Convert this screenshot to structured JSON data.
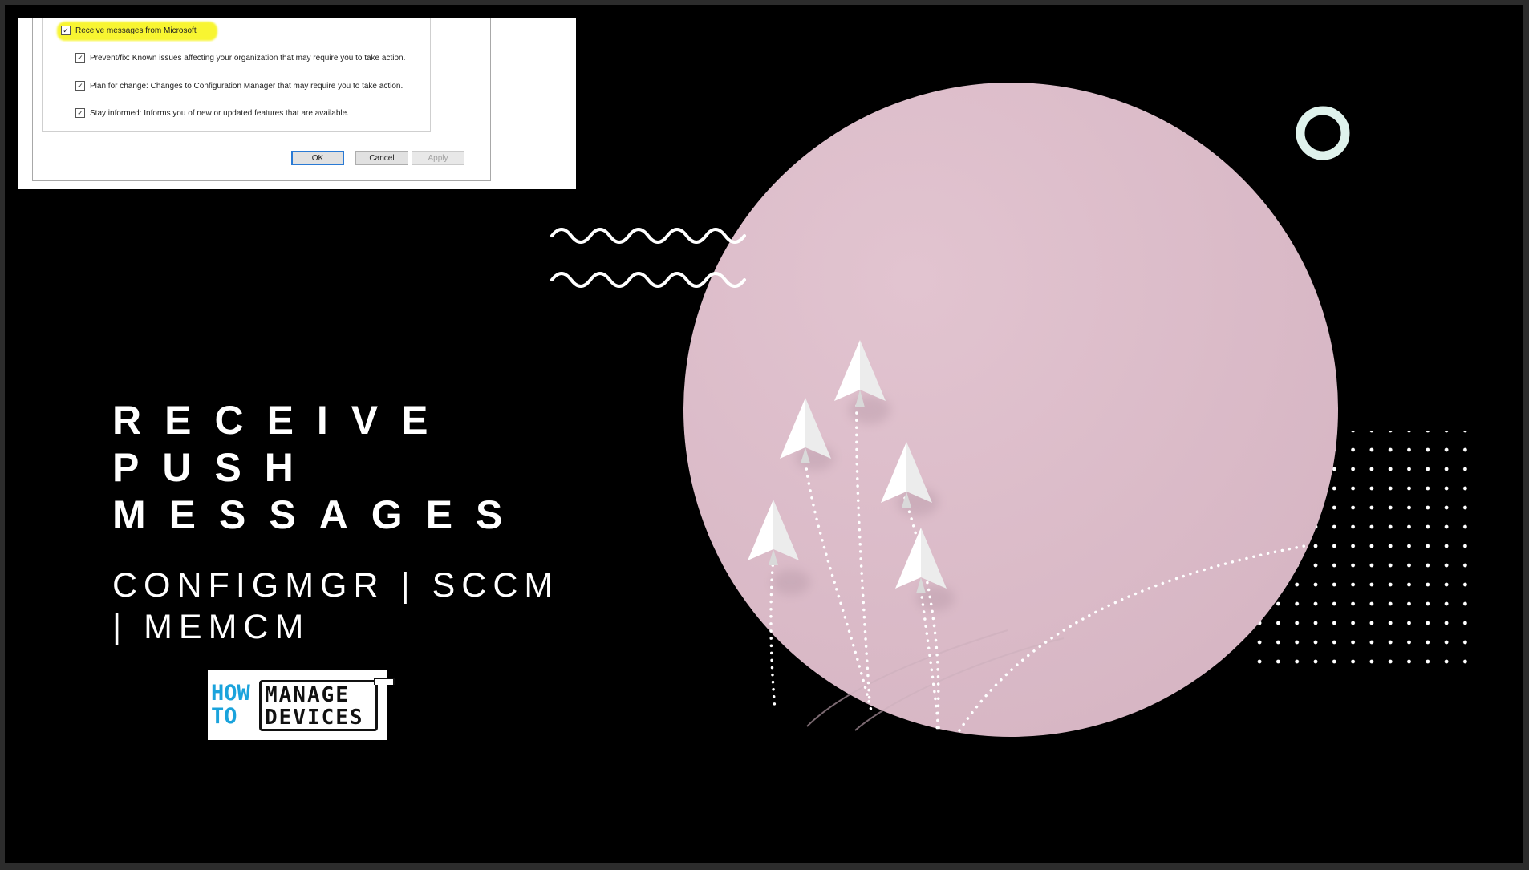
{
  "dialog": {
    "main_option": "Receive messages from Microsoft",
    "options": [
      "Prevent/fix: Known issues affecting your organization that may require you to take action.",
      "Plan for change: Changes to Configuration Manager that may require you to take action.",
      "Stay informed: Informs you of new or updated features that are available."
    ],
    "buttons": {
      "ok": "OK",
      "cancel": "Cancel",
      "apply": "Apply"
    }
  },
  "title": {
    "line1": "RECEIVE",
    "line2": "PUSH",
    "line3": "MESSAGES"
  },
  "subtitle": {
    "line1": "CONFIGMGR | SCCM",
    "line2": "| MEMCM"
  },
  "logo": {
    "how": "HOW",
    "to": "TO",
    "manage": "MANAGE",
    "devices": "DEVICES"
  },
  "colors": {
    "background": "#000000",
    "circle": "#dcbfcb",
    "highlight": "#f6f22a",
    "logo_blue": "#1aa3dc",
    "ring": "#dff2ec"
  }
}
